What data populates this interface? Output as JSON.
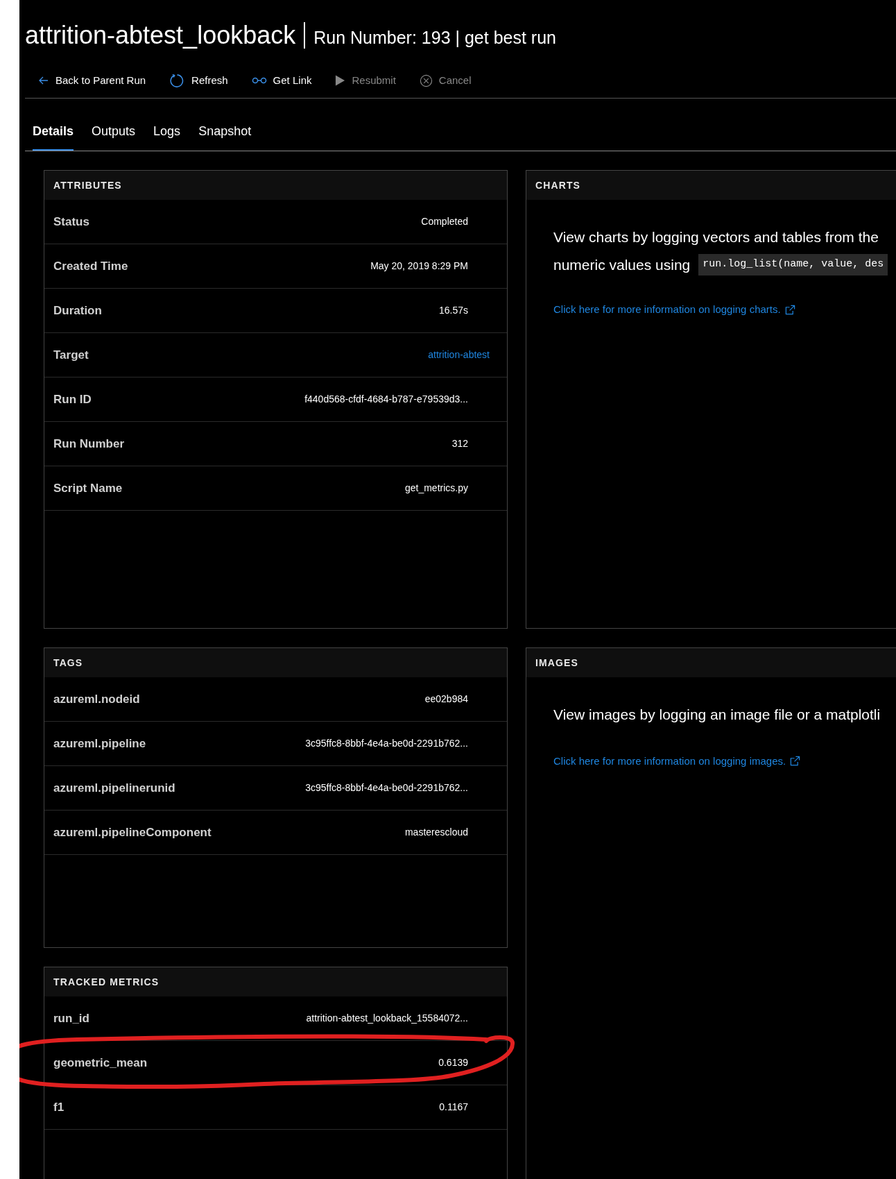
{
  "title": {
    "main": "attrition-abtest_lookback",
    "sub": "Run Number: 193 | get best run"
  },
  "toolbar": [
    {
      "kind": "back",
      "label": "Back to Parent Run",
      "disabled": false
    },
    {
      "kind": "refresh",
      "label": "Refresh",
      "disabled": false
    },
    {
      "kind": "link",
      "label": "Get Link",
      "disabled": false
    },
    {
      "kind": "resubmit",
      "label": "Resubmit",
      "disabled": true
    },
    {
      "kind": "cancel",
      "label": "Cancel",
      "disabled": true
    }
  ],
  "tabs": [
    {
      "label": "Details",
      "selected": true
    },
    {
      "label": "Outputs",
      "selected": false
    },
    {
      "label": "Logs",
      "selected": false
    },
    {
      "label": "Snapshot",
      "selected": false
    }
  ],
  "attributes": {
    "heading": "ATTRIBUTES",
    "rows": [
      {
        "label": "Status",
        "value": "Completed",
        "kind": "text"
      },
      {
        "label": "Created Time",
        "value": "May 20, 2019 8:29 PM",
        "kind": "text"
      },
      {
        "label": "Duration",
        "value": "16.57s",
        "kind": "text"
      },
      {
        "label": "Target",
        "value": "attrition-abtest",
        "kind": "link"
      },
      {
        "label": "Run ID",
        "value": "f440d568-cfdf-4684-b787-e79539d3...",
        "kind": "text"
      },
      {
        "label": "Run Number",
        "value": "312",
        "kind": "text"
      },
      {
        "label": "Script Name",
        "value": "get_metrics.py",
        "kind": "text"
      }
    ]
  },
  "tags": {
    "heading": "TAGS",
    "rows": [
      {
        "label": "azureml.nodeid",
        "value": "ee02b984"
      },
      {
        "label": "azureml.pipeline",
        "value": "3c95ffc8-8bbf-4e4a-be0d-2291b762..."
      },
      {
        "label": "azureml.pipelinerunid",
        "value": "3c95ffc8-8bbf-4e4a-be0d-2291b762..."
      },
      {
        "label": "azureml.pipelineComponent",
        "value": "masterescloud"
      }
    ]
  },
  "tracked_metrics": {
    "heading": "TRACKED METRICS",
    "rows": [
      {
        "label": "run_id",
        "value": "attrition-abtest_lookback_15584072...",
        "circled": false
      },
      {
        "label": "geometric_mean",
        "value": "0.6139",
        "circled": true
      },
      {
        "label": "f1",
        "value": "0.1167",
        "circled": false
      }
    ]
  },
  "charts": {
    "heading": "CHARTS",
    "text": "View charts by logging vectors and tables from the",
    "text2": "numeric values using",
    "code": "run.log_list(name, value, des",
    "link": "Click here for more information on logging charts."
  },
  "images": {
    "heading": "IMAGES",
    "text": "View images by logging an image file or a matplotli",
    "link": "Click here for more information on logging images."
  }
}
